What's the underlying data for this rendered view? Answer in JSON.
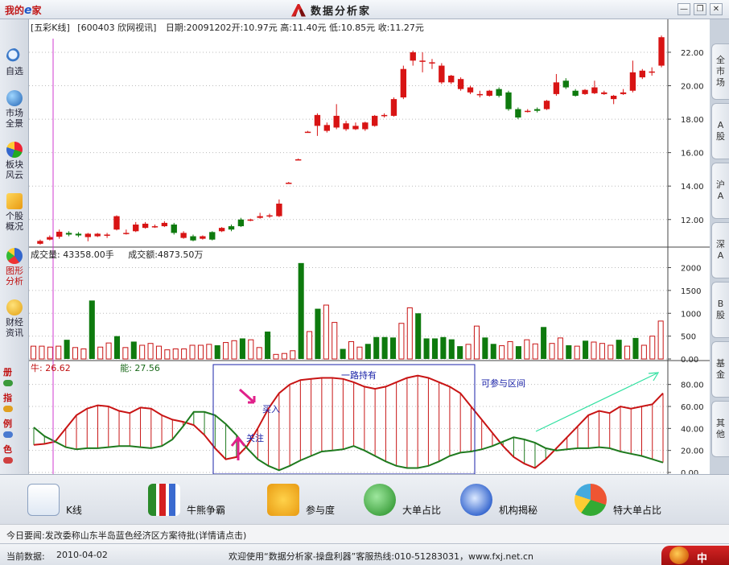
{
  "titlebar": {
    "logo_text": "我的",
    "logo_e": "e",
    "logo_suffix": "家",
    "app_title": "数据分析家",
    "minimize": "—",
    "restore": "❐",
    "close": "✕"
  },
  "sidebar": {
    "items": [
      {
        "label": "自选",
        "icon": "magnifier-icon"
      },
      {
        "label": "市场全景",
        "icon": "globe-icon"
      },
      {
        "label": "板块风云",
        "icon": "pie-icon"
      },
      {
        "label": "个股概况",
        "icon": "trend-icon"
      },
      {
        "label": "图形分析",
        "icon": "chart-pie-icon"
      },
      {
        "label": "财经资讯",
        "icon": "coin-icon"
      }
    ],
    "small": [
      "册",
      "指",
      "例",
      "色"
    ]
  },
  "chart": {
    "header": {
      "mode": "[五彩K线]",
      "stock": "[600403 欣网视讯]",
      "date": "日期:20091202",
      "open": "开:10.97元",
      "high": "高:11.40元",
      "low": "低:10.85元",
      "close": "收:11.27元"
    },
    "volume_header": {
      "volume": "成交量: 43358.00手",
      "turnover": "成交额:4873.50万"
    },
    "indicator_header": {
      "bull": "牛: 26.62",
      "bull_label": "牛",
      "bull_value": ": 26.62",
      "energy_label": "能",
      "energy_value": ": 27.56"
    },
    "annotations": {
      "hold": "一路持有",
      "buy": "买入",
      "watch": "关注",
      "zone": "可参与区间"
    },
    "price_ticks": [
      "22.00",
      "20.00",
      "18.00",
      "16.00",
      "14.00",
      "12.00"
    ],
    "volume_ticks": [
      "2000",
      "1500",
      "1000",
      "500",
      "0.00"
    ],
    "indicator_ticks": [
      "80.00",
      "60.00",
      "40.00",
      "20.00",
      "0.00"
    ]
  },
  "chart_data": [
    {
      "type": "candlestick",
      "title": "",
      "ylim": [
        10.4,
        23.2
      ],
      "y_ticks": [
        12,
        14,
        16,
        18,
        20,
        22
      ],
      "up_color": "#d81414",
      "down_color": "#0e7a0e",
      "doji_color": "#33ddee",
      "candles": [
        {
          "o": 10.55,
          "c": 10.72,
          "h": 10.8,
          "l": 10.5
        },
        {
          "o": 10.8,
          "c": 10.95,
          "h": 11.05,
          "l": 10.75
        },
        {
          "o": 10.97,
          "c": 11.27,
          "h": 11.4,
          "l": 10.85
        },
        {
          "o": 11.2,
          "c": 11.1,
          "h": 11.3,
          "l": 11.0
        },
        {
          "o": 11.15,
          "c": 11.05,
          "h": 11.25,
          "l": 10.95
        },
        {
          "o": 10.95,
          "c": 11.15,
          "h": 11.2,
          "l": 10.7
        },
        {
          "o": 11.0,
          "c": 11.15,
          "h": 11.2,
          "l": 10.95
        },
        {
          "o": 11.1,
          "c": 11.1,
          "h": 11.2,
          "l": 10.9
        },
        {
          "o": 11.4,
          "c": 12.2,
          "h": 12.25,
          "l": 11.35
        },
        {
          "o": 11.2,
          "c": 11.2,
          "h": 11.4,
          "l": 11.1
        },
        {
          "o": 11.3,
          "c": 11.7,
          "h": 11.85,
          "l": 11.25
        },
        {
          "o": 11.5,
          "c": 11.75,
          "h": 11.85,
          "l": 11.45
        },
        {
          "o": 11.6,
          "c": 11.6,
          "h": 11.7,
          "l": 11.5
        },
        {
          "o": 11.6,
          "c": 11.8,
          "h": 11.9,
          "l": 11.55
        },
        {
          "o": 11.7,
          "c": 11.2,
          "h": 11.8,
          "l": 11.1
        },
        {
          "o": 10.9,
          "c": 11.2,
          "h": 11.3,
          "l": 10.85
        },
        {
          "o": 11.0,
          "c": 10.75,
          "h": 11.1,
          "l": 10.7
        },
        {
          "o": 10.85,
          "c": 11.0,
          "h": 11.05,
          "l": 10.8
        },
        {
          "o": 11.25,
          "c": 10.8,
          "h": 11.3,
          "l": 10.75
        },
        {
          "o": 11.3,
          "c": 11.5,
          "h": 11.55,
          "l": 11.25
        },
        {
          "o": 11.6,
          "c": 11.4,
          "h": 11.7,
          "l": 11.3
        },
        {
          "o": 12.0,
          "c": 11.6,
          "h": 12.1,
          "l": 11.55
        },
        {
          "o": 12.0,
          "c": 12.0,
          "h": 12.05,
          "l": 11.9
        },
        {
          "o": 12.1,
          "c": 12.2,
          "h": 12.4,
          "l": 12.05
        },
        {
          "o": 12.2,
          "c": 12.25,
          "h": 12.35,
          "l": 12.1
        },
        {
          "o": 12.2,
          "c": 12.95,
          "h": 13.2,
          "l": 12.15
        },
        {
          "o": 14.2,
          "c": 14.2,
          "h": 14.25,
          "l": 14.2
        },
        {
          "o": 15.6,
          "c": 15.6,
          "h": 15.65,
          "l": 15.6
        },
        {
          "o": 17.25,
          "c": 17.25,
          "h": 17.3,
          "l": 17.2
        },
        {
          "o": 17.6,
          "c": 18.25,
          "h": 18.35,
          "l": 17.0
        },
        {
          "o": 17.3,
          "c": 17.65,
          "h": 17.8,
          "l": 17.2
        },
        {
          "o": 17.5,
          "c": 18.2,
          "h": 18.9,
          "l": 17.4
        },
        {
          "o": 17.4,
          "c": 17.75,
          "h": 17.9,
          "l": 17.3
        },
        {
          "o": 17.4,
          "c": 17.6,
          "h": 17.8,
          "l": 17.35
        },
        {
          "o": 17.4,
          "c": 17.8,
          "h": 17.85,
          "l": 17.3
        },
        {
          "o": 17.6,
          "c": 18.2,
          "h": 18.25,
          "l": 17.55
        },
        {
          "o": 18.2,
          "c": 18.25,
          "h": 18.35,
          "l": 18.1
        },
        {
          "o": 18.2,
          "c": 19.2,
          "h": 19.3,
          "l": 18.15
        },
        {
          "o": 19.3,
          "c": 21.0,
          "h": 21.2,
          "l": 19.2
        },
        {
          "o": 21.5,
          "c": 22.0,
          "h": 22.1,
          "l": 21.2
        },
        {
          "o": 21.5,
          "c": 21.5,
          "h": 22.0,
          "l": 20.8
        },
        {
          "o": 21.4,
          "c": 21.4,
          "h": 21.6,
          "l": 21.0
        },
        {
          "o": 20.2,
          "c": 21.2,
          "h": 21.35,
          "l": 20.1
        },
        {
          "o": 20.2,
          "c": 20.6,
          "h": 20.65,
          "l": 20.1
        },
        {
          "o": 19.8,
          "c": 20.4,
          "h": 20.5,
          "l": 19.7
        },
        {
          "o": 19.6,
          "c": 19.9,
          "h": 20.0,
          "l": 19.5
        },
        {
          "o": 19.5,
          "c": 19.5,
          "h": 19.7,
          "l": 19.3
        },
        {
          "o": 19.4,
          "c": 19.7,
          "h": 19.75,
          "l": 19.35
        },
        {
          "o": 19.8,
          "c": 19.4,
          "h": 19.9,
          "l": 19.3
        },
        {
          "o": 19.6,
          "c": 18.6,
          "h": 19.7,
          "l": 18.5
        },
        {
          "o": 18.6,
          "c": 18.1,
          "h": 18.7,
          "l": 18.0
        },
        {
          "o": 18.5,
          "c": 18.5,
          "h": 18.6,
          "l": 18.4
        },
        {
          "o": 18.6,
          "c": 18.5,
          "h": 18.7,
          "l": 18.4
        },
        {
          "o": 18.6,
          "c": 19.1,
          "h": 19.15,
          "l": 18.55
        },
        {
          "o": 19.5,
          "c": 20.2,
          "h": 20.7,
          "l": 19.4
        },
        {
          "o": 20.3,
          "c": 19.9,
          "h": 20.45,
          "l": 19.8
        },
        {
          "o": 19.7,
          "c": 19.4,
          "h": 19.8,
          "l": 19.35
        },
        {
          "o": 19.5,
          "c": 19.75,
          "h": 19.8,
          "l": 19.45
        },
        {
          "o": 19.55,
          "c": 19.9,
          "h": 20.3,
          "l": 19.5
        },
        {
          "o": 19.5,
          "c": 19.6,
          "h": 19.7,
          "l": 19.45
        },
        {
          "o": 19.2,
          "c": 19.4,
          "h": 19.45,
          "l": 18.9
        },
        {
          "o": 19.5,
          "c": 19.6,
          "h": 19.8,
          "l": 19.45
        },
        {
          "o": 19.7,
          "c": 20.8,
          "h": 21.5,
          "l": 19.6
        },
        {
          "o": 20.5,
          "c": 20.9,
          "h": 21.0,
          "l": 20.4
        },
        {
          "o": 20.85,
          "c": 20.85,
          "h": 21.1,
          "l": 20.6
        },
        {
          "o": 21.2,
          "c": 22.9,
          "h": 23.0,
          "l": 21.1
        }
      ]
    },
    {
      "type": "bar",
      "title": "",
      "ylim": [
        0,
        2150
      ],
      "y_ticks": [
        0,
        500,
        1000,
        1500,
        2000
      ],
      "values": [
        280,
        280,
        260,
        280,
        420,
        250,
        220,
        1280,
        260,
        350,
        500,
        250,
        380,
        300,
        340,
        280,
        200,
        220,
        220,
        300,
        300,
        320,
        300,
        360,
        400,
        450,
        420,
        250,
        600,
        100,
        120,
        180,
        2100,
        600,
        1100,
        1180,
        800,
        220,
        380,
        260,
        330,
        480,
        480,
        470,
        780,
        1120,
        1000,
        450,
        450,
        480,
        430,
        280,
        320,
        720,
        470,
        330,
        290,
        380,
        280,
        420,
        330,
        700,
        340,
        460,
        300,
        280,
        400,
        370,
        340,
        300,
        420,
        280,
        460,
        300,
        500,
        830
      ],
      "colors": "red=outline up, green=filled down"
    },
    {
      "type": "line",
      "title": "",
      "ylim": [
        0,
        90
      ],
      "y_ticks": [
        0,
        20,
        40,
        60,
        80
      ],
      "series": [
        {
          "name": "牛",
          "color": "#c81414",
          "values": [
            25,
            26,
            28,
            40,
            52,
            58,
            61,
            60,
            56,
            54,
            59,
            58,
            52,
            48,
            46,
            43,
            34,
            22,
            12,
            14,
            24,
            40,
            58,
            72,
            80,
            84,
            85,
            86,
            86,
            85,
            82,
            78,
            76,
            78,
            82,
            86,
            88,
            86,
            82,
            78,
            72,
            60,
            48,
            36,
            24,
            14,
            8,
            4,
            12,
            22,
            32,
            42,
            52,
            56,
            54,
            60,
            58,
            60,
            62,
            72
          ]
        },
        {
          "name": "能",
          "color": "#1e7a1e",
          "values": [
            41,
            33,
            28,
            23,
            21,
            22,
            22,
            23,
            24,
            24,
            23,
            22,
            24,
            30,
            42,
            55,
            55,
            52,
            44,
            34,
            22,
            12,
            6,
            2,
            6,
            11,
            15,
            19,
            20,
            21,
            24,
            20,
            15,
            10,
            6,
            4,
            4,
            6,
            10,
            15,
            18,
            19,
            21,
            24,
            28,
            32,
            30,
            27,
            22,
            20,
            21,
            22,
            22,
            23,
            22,
            19,
            17,
            15,
            12,
            9
          ]
        }
      ]
    }
  ],
  "righttabs": [
    {
      "label": "全市场",
      "chars": [
        "全",
        "市",
        "场"
      ]
    },
    {
      "label": "A股",
      "chars": [
        "A",
        "股"
      ]
    },
    {
      "label": "沪A",
      "chars": [
        "沪",
        "A"
      ]
    },
    {
      "label": "深A",
      "chars": [
        "深",
        "A"
      ]
    },
    {
      "label": "B股",
      "chars": [
        "B",
        "股"
      ]
    },
    {
      "label": "基金",
      "chars": [
        "基",
        "金"
      ]
    },
    {
      "label": "其他",
      "chars": [
        "其",
        "他"
      ]
    }
  ],
  "toolbar": {
    "items": [
      {
        "label": "K线",
        "icon": "kline-chart-icon"
      },
      {
        "label": "牛熊争霸",
        "icon": "bull-bear-icon"
      },
      {
        "label": "参与度",
        "icon": "percent-icon"
      },
      {
        "label": "大单占比",
        "icon": "big-order-icon"
      },
      {
        "label": "机构揭秘",
        "icon": "compass-icon"
      },
      {
        "label": "特大单占比",
        "icon": "pie-chart-icon"
      }
    ]
  },
  "news": {
    "label": "今日要闻:",
    "text": "发改委称山东半岛蓝色经济区方案待批",
    "link": "(详情请点击)"
  },
  "status": {
    "date_label": "当前数据:",
    "date": "2010-04-02",
    "welcome": "欢迎使用“数据分析家-操盘利器”客服热线:010-51283031，www.fxj.net.cn",
    "china": "中"
  }
}
